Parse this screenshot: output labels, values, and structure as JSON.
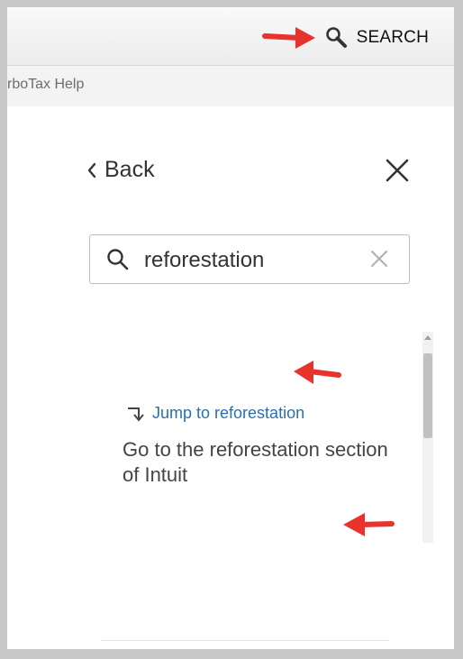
{
  "topbar": {
    "search_label": "SEARCH"
  },
  "helpbar": {
    "title": "rboTax Help"
  },
  "panel": {
    "back_label": "Back",
    "search": {
      "value": "reforestation"
    },
    "result": {
      "link": "Jump to reforestation",
      "description": "Go to the reforestation section of Intuit"
    }
  },
  "icons": {
    "search": "magnifier-icon",
    "back": "chevron-left-icon",
    "close": "close-icon",
    "clear": "clear-icon",
    "jump": "jump-arrow-icon",
    "annotation": "red-arrow-icon"
  },
  "colors": {
    "link": "#2a6fb0",
    "annotation_arrow": "#e8332c"
  }
}
